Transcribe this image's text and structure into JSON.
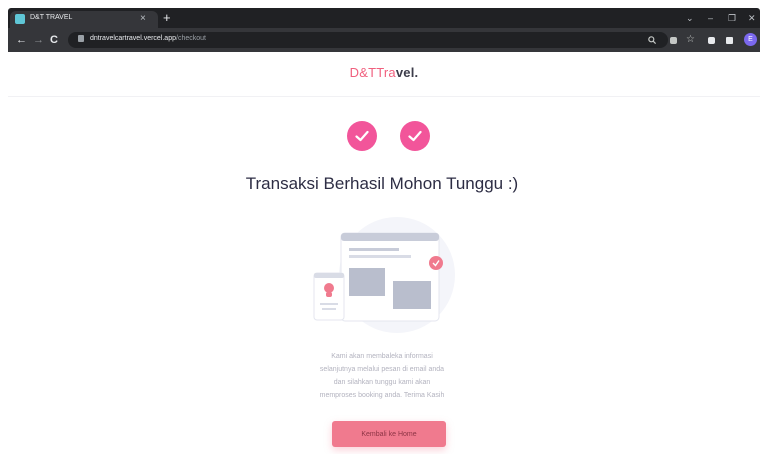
{
  "browser": {
    "tab_title": "D&T TRAVEL",
    "tab_close": "×",
    "new_tab": "+",
    "url_host": "dntravelcartravel.vercel.app",
    "url_path": "/checkout",
    "window_controls": [
      "⌄",
      "–",
      "❐",
      "✕"
    ],
    "nav": {
      "back": "←",
      "forward": "→",
      "reload": "C"
    },
    "profile_initial": "E"
  },
  "header": {
    "logo_part1": "D&TTra",
    "logo_part2": "vel."
  },
  "main": {
    "heading": "Transaksi Berhasil Mohon Tunggu :)",
    "description_lines": [
      "Kami akan membaleka informasi",
      "selanjutnya melalui pesan di email anda",
      "dan silahkan tunggu kami akan",
      "memproses booking anda. Terima Kasih"
    ],
    "home_button": "Kembali ke Home"
  },
  "colors": {
    "accent_pink": "#f2559a",
    "button_pink": "#f07a8e",
    "logo_pink": "#f0607e",
    "text_dark": "#2d2d44"
  },
  "icons": [
    "check-icon",
    "lock-icon",
    "search-icon",
    "share-icon",
    "star-icon",
    "extensions-icon",
    "sidepanel-icon"
  ]
}
